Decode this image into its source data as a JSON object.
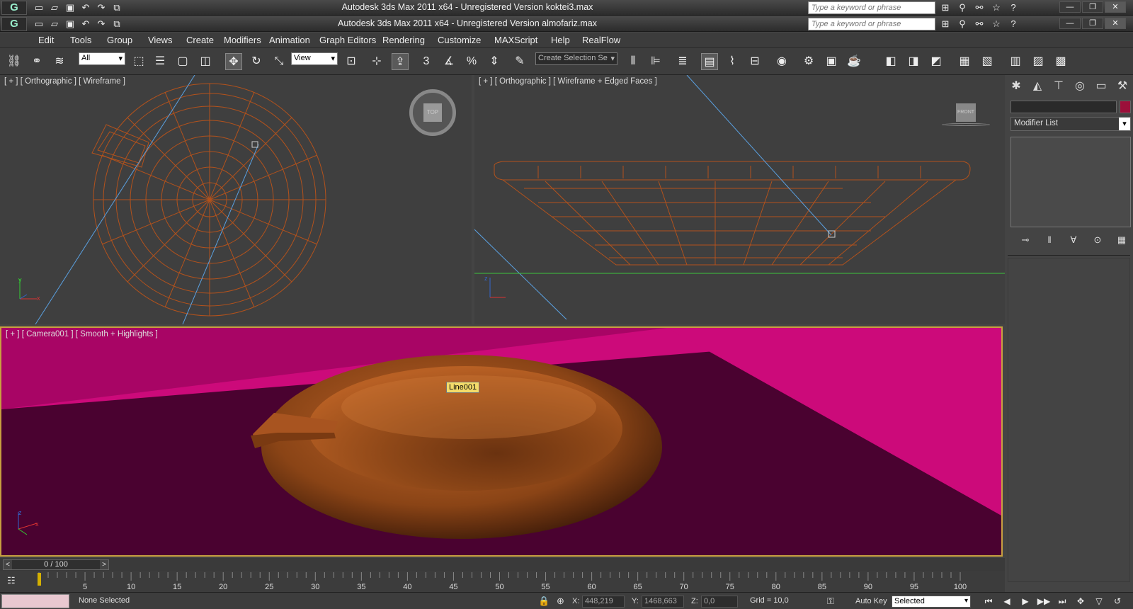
{
  "windows": [
    {
      "title": "Autodesk 3ds Max  2011 x64  -  Unregistered Version    koktei3.max"
    },
    {
      "title": "Autodesk 3ds Max  2011 x64  -  Unregistered Version    almofariz.max"
    }
  ],
  "search_placeholder": "Type a keyword or phrase",
  "menu": [
    "Edit",
    "Tools",
    "Group",
    "Views",
    "Create",
    "Modifiers",
    "Animation",
    "Graph Editors",
    "Rendering",
    "Customize",
    "MAXScript",
    "Help",
    "RealFlow"
  ],
  "toolbar": {
    "selection_filter": "All",
    "reference_coord": "View",
    "named_selection": "Create Selection Se"
  },
  "viewports": {
    "top_left": {
      "label": "[ + ] [ Orthographic ] [ Wireframe ]",
      "viewcube": "TOP"
    },
    "top_right": {
      "label": "[ + ] [ Orthographic ] [ Wireframe + Edged Faces ]",
      "viewcube": "FRONT"
    },
    "bottom": {
      "label": "[ + ] [ Camera001 ] [ Smooth + Highlights ]",
      "tooltip": "Line001"
    }
  },
  "axis": {
    "x": "x",
    "y": "y",
    "z": "z"
  },
  "command_panel": {
    "modifier_list": "Modifier List",
    "object_color": "#9c0f3a"
  },
  "timeslider": {
    "value": "0 / 100",
    "prev": "<",
    "next": ">"
  },
  "timeline_ticks": [
    "5",
    "10",
    "15",
    "20",
    "25",
    "30",
    "35",
    "40",
    "45",
    "50",
    "55",
    "60",
    "65",
    "70",
    "75",
    "80",
    "85",
    "90",
    "95",
    "100"
  ],
  "status": {
    "selection": "None Selected",
    "x_label": "X:",
    "x": "448,219",
    "y_label": "Y:",
    "y": "1468,663",
    "z_label": "Z:",
    "z": "0,0",
    "grid": "Grid = 10,0",
    "autokey": "Auto Key",
    "key_filter": "Selected"
  },
  "colors": {
    "wire": "#b3521c",
    "camera_bg_light": "#cc0a7a",
    "camera_bg_dark": "#4a0230",
    "object": "#8a4416"
  }
}
